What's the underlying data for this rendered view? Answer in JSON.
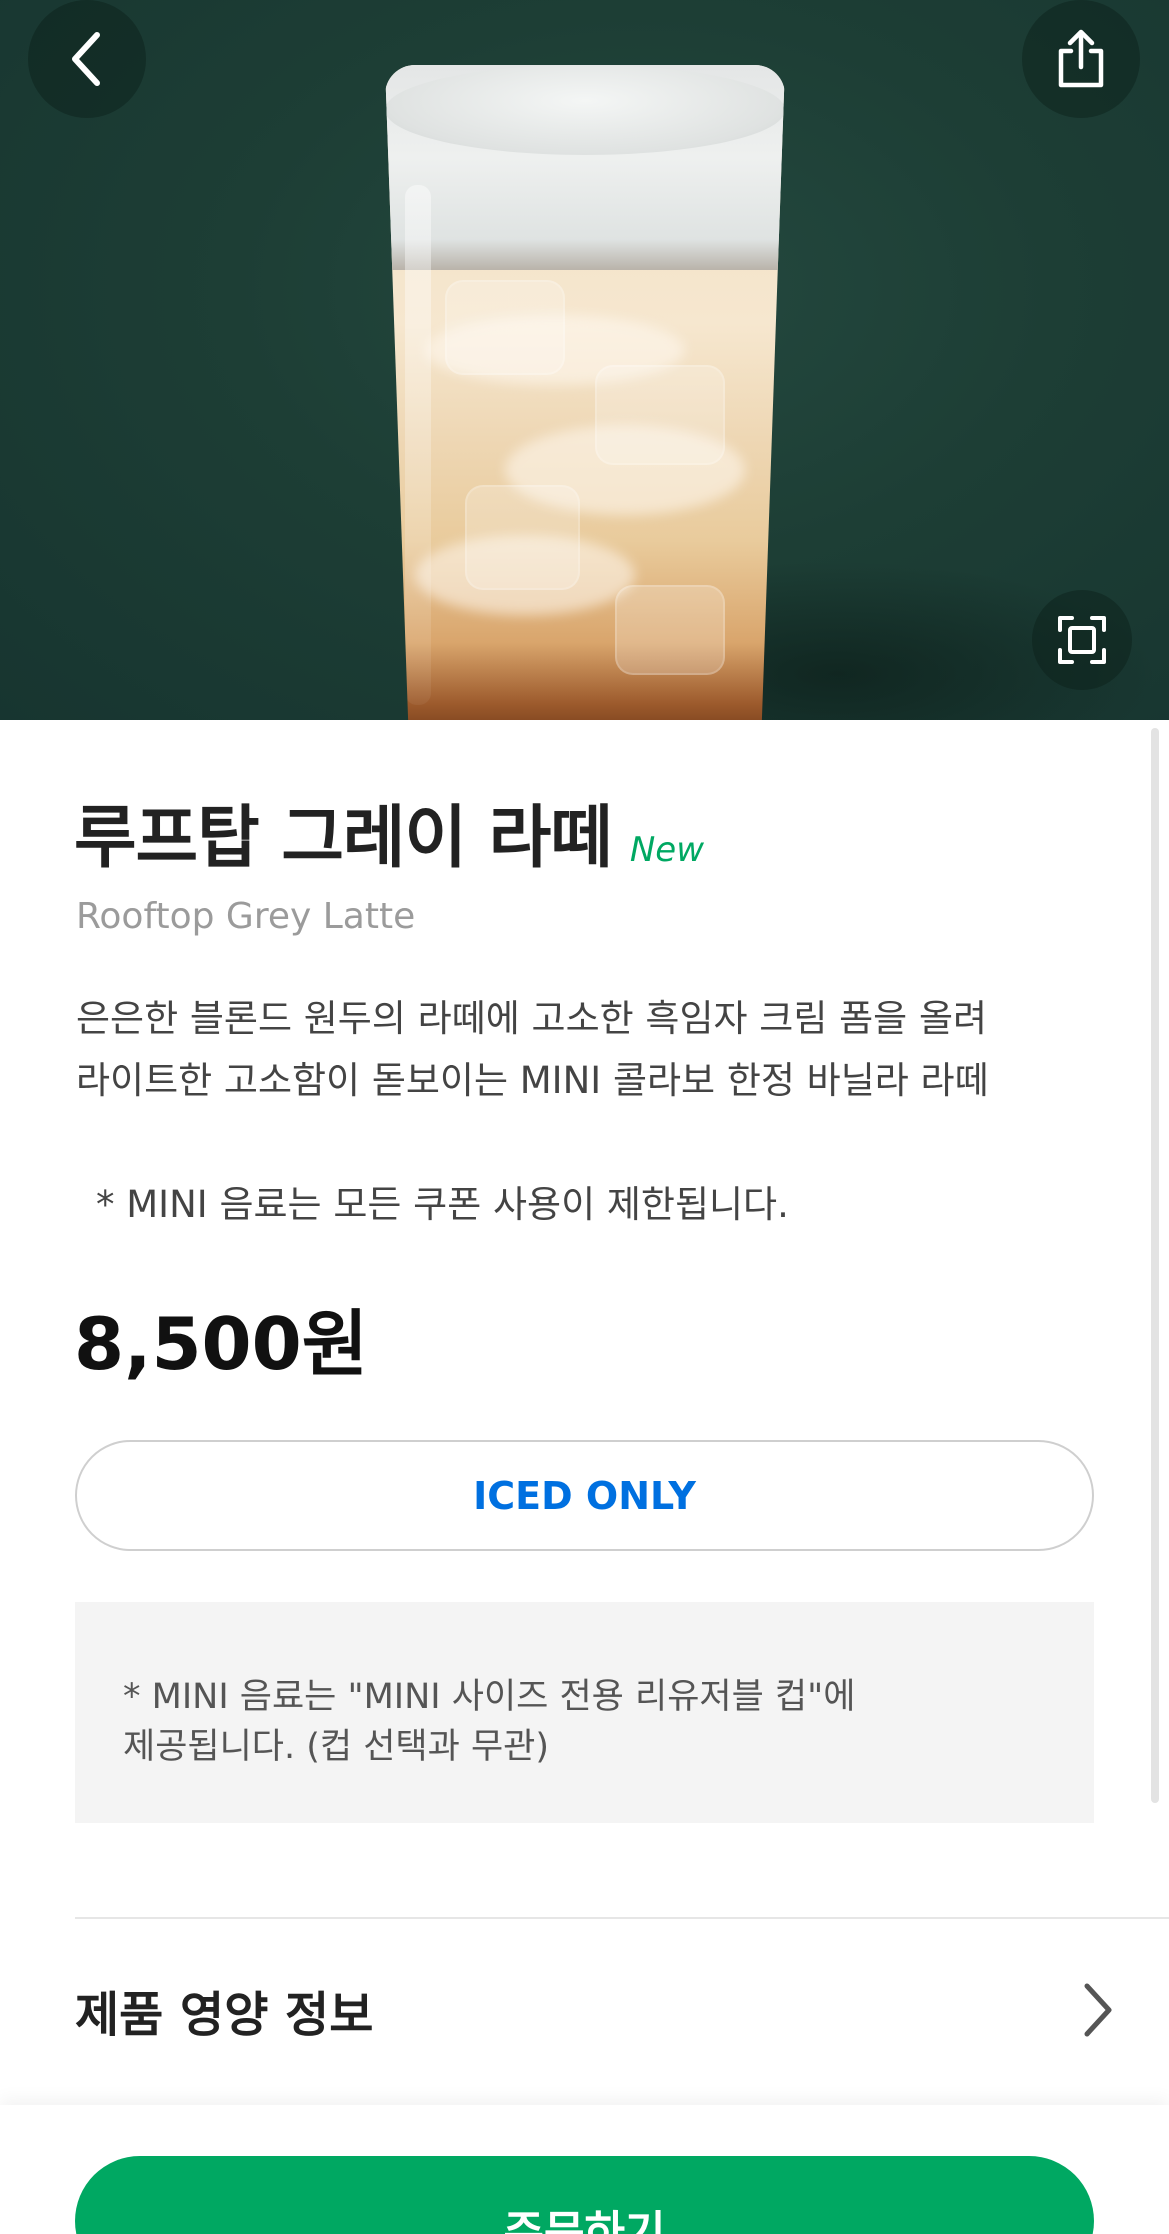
{
  "product": {
    "name_ko": "루프탑 그레이 라떼",
    "badge": "New",
    "name_en": "Rooftop Grey Latte",
    "description_lines": [
      "은은한 블론드 원두의 라떼에 고소한 흑임자 크림 폼을 올려",
      "라이트한 고소함이 돋보이는 MINI 콜라보 한정 바닐라 라떼"
    ],
    "notice": "* MINI 음료는 모든 쿠폰 사용이 제한됩니다.",
    "price": "8,500원",
    "temperature_option": "ICED ONLY",
    "info_box_lines": [
      "* MINI 음료는 \"MINI 사이즈 전용 리유저블 컵\"에",
      "제공됩니다. (컵 선택과 무관)"
    ]
  },
  "nutrition": {
    "label": "제품 영양 정보"
  },
  "actions": {
    "order_label": "주문하기"
  },
  "icons": {
    "back": "back-arrow-icon",
    "share": "share-icon",
    "fullscreen": "fullscreen-icon",
    "chevron": "chevron-right-icon"
  },
  "colors": {
    "brand_green": "#00a862",
    "hero_background": "#1d3e35",
    "option_blue": "#0070e0"
  }
}
